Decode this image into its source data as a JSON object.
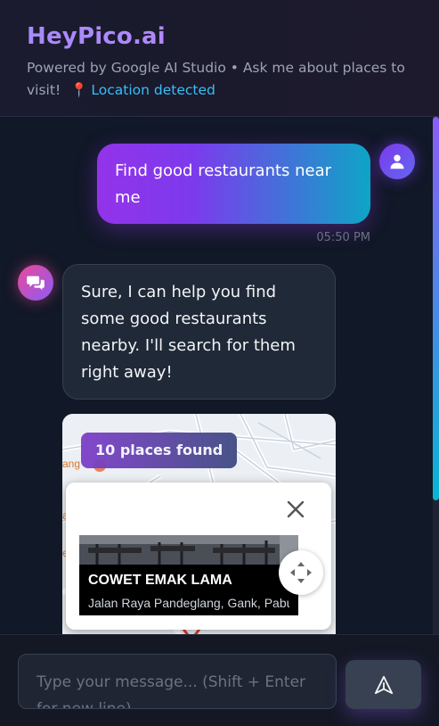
{
  "header": {
    "brand": "HeyPico.ai",
    "subtitle": "Powered by Google AI Studio • Ask me about places to visit!",
    "location_icon": "📍",
    "location_text": "Location detected"
  },
  "messages": [
    {
      "role": "user",
      "text": "Find good restaurants near me",
      "time": "05:50 PM",
      "avatar_icon": "user-icon"
    },
    {
      "role": "assistant",
      "text": "Sure, I can help you find some good restaurants nearby. I'll search for them right away!",
      "avatar_icon": "chat-bubbles-icon"
    }
  ],
  "map": {
    "badge": "10 places found",
    "info_window": {
      "name": "COWET EMAK LAMA",
      "address": "Jalan Raya Pandeglang, Gank, Pabuaran, Serang, Banten"
    }
  },
  "composer": {
    "placeholder": "Type your message... (Shift + Enter for new line)",
    "value": "",
    "send_icon": "send-icon"
  },
  "colors": {
    "brand_gradient_start": "#a78bfa",
    "user_bubble_start": "#9333ea",
    "user_bubble_end": "#0ea5c6",
    "location_text": "#38bdf8",
    "background": "#111827"
  }
}
